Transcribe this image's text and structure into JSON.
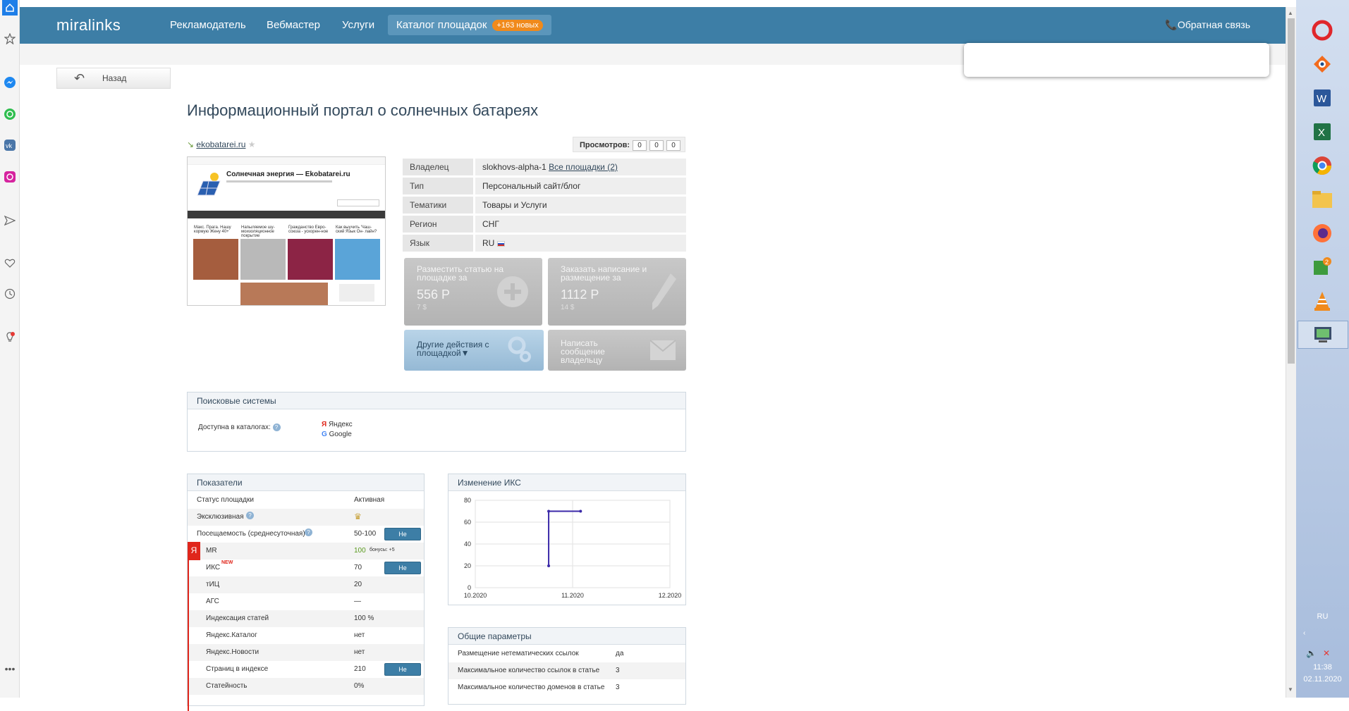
{
  "nav": {
    "logo": "miralinks",
    "links": [
      "Рекламодатель",
      "Вебмастер",
      "Услуги"
    ],
    "catalog_label": "Каталог площадок",
    "catalog_badge": "+163 новых",
    "feedback": "Обратная связь"
  },
  "back_label": "Назад",
  "page_title": "Информационный портал о солнечных батареях",
  "site_url": "ekobatarei.ru",
  "views": {
    "label": "Просмотров:",
    "values": [
      "0",
      "0",
      "0"
    ]
  },
  "thumbnail": {
    "site_title": "Солнечная энергия — Ekobatarei.ru",
    "cards": [
      "Макс. Прага. Нашу кормую Жену 40+",
      "Напыляемое шу-моизоляционное покрытие",
      "Гражданство Евро-союза - ускорен-ное",
      "Как выучить 'Чаш- ский Язык Он- лайн?"
    ]
  },
  "info": {
    "rows": [
      {
        "label": "Владелец",
        "value": "slokhovs-alpha-1",
        "link": "Все площадки (2)"
      },
      {
        "label": "Тип",
        "value": "Персональный сайт/блог"
      },
      {
        "label": "Тематики",
        "value": "Товары и Услуги"
      },
      {
        "label": "Регион",
        "value": "СНГ"
      },
      {
        "label": "Язык",
        "value": "RU"
      }
    ]
  },
  "actions": {
    "place_article": {
      "label": "Разместить статью на площадке за",
      "price": "556 Р",
      "sub": "7 $"
    },
    "order_writing": {
      "label": "Заказать написание и размещение за",
      "price": "1112 Р",
      "sub": "14 $"
    },
    "other_actions": "Другие действия с площадкой▼",
    "message_owner": "Написать сообщение владельцу"
  },
  "search_systems": {
    "title": "Поисковые системы",
    "label": "Доступна в каталогах:",
    "engines": [
      "Яндекс",
      "Google"
    ]
  },
  "metrics": {
    "title": "Показатели",
    "disagree_label": "Не согласен",
    "new_tag": "NEW",
    "rows": [
      {
        "name": "Статус площадки",
        "value": "Активная"
      },
      {
        "name": "Эксклюзивная",
        "value": ""
      },
      {
        "name": "Посещаемость (среднесуточная)",
        "value": "50-100"
      },
      {
        "name": "MR",
        "value": "100",
        "extra": "бонусы: +5"
      },
      {
        "name": "ИКС",
        "value": "70"
      },
      {
        "name": "тИЦ",
        "value": "20"
      },
      {
        "name": "АГС",
        "value": "—"
      },
      {
        "name": "Индексация статей",
        "value": "100 %"
      },
      {
        "name": "Яндекс.Каталог",
        "value": "нет"
      },
      {
        "name": "Яндекс.Новости",
        "value": "нет"
      },
      {
        "name": "Страниц в индексе",
        "value": "210"
      },
      {
        "name": "Статейность",
        "value": "0%"
      }
    ]
  },
  "iks_panel": {
    "title": "Изменение ИКС"
  },
  "chart_data": {
    "type": "line",
    "title": "Изменение ИКС",
    "x_ticks": [
      "10.2020",
      "11.2020",
      "12.2020"
    ],
    "y_ticks": [
      "0",
      "20",
      "40",
      "60",
      "80"
    ],
    "ylim": [
      0,
      80
    ],
    "xlim": [
      "2020-10-01",
      "2020-12-01"
    ],
    "points": [
      {
        "x": "2020-10-24",
        "y": 20
      },
      {
        "x": "2020-10-24",
        "y": 70
      },
      {
        "x": "2020-11-03",
        "y": 70
      }
    ],
    "color": "#3b2aa8"
  },
  "general": {
    "title": "Общие параметры",
    "rows": [
      {
        "name": "Размещение нетематических ссылок",
        "value": "да"
      },
      {
        "name": "Максимальное количество ссылок в статье",
        "value": "3"
      },
      {
        "name": "Максимальное количество доменов в статье",
        "value": "3"
      }
    ]
  },
  "taskbar": {
    "lang": "RU",
    "time": "11:38",
    "date": "02.11.2020",
    "badge": "2"
  },
  "colors": {
    "nav": "#3d7ea6",
    "accent_orange": "#f08a1c",
    "yandex_red": "#e0261b",
    "chart_line": "#3b2aa8"
  }
}
